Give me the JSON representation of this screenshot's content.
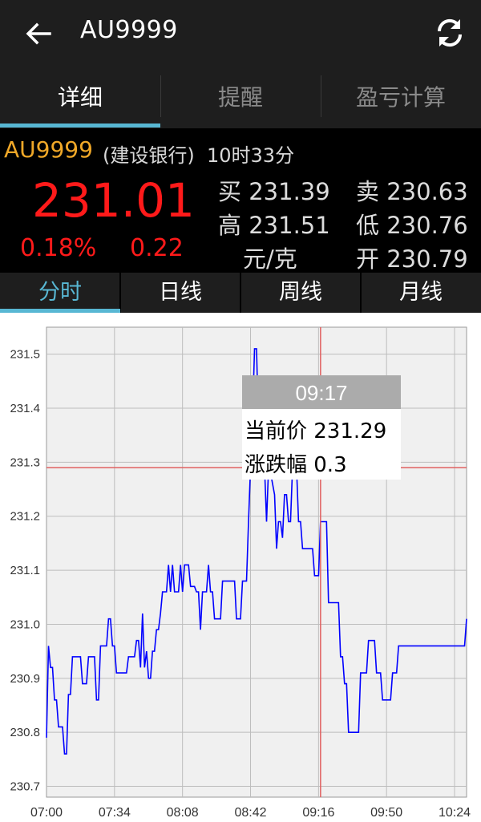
{
  "appbar": {
    "title": "AU9999",
    "back_icon": "arrow-left-icon",
    "refresh_icon": "refresh-icon"
  },
  "tabs": [
    {
      "label": "详细"
    },
    {
      "label": "提醒"
    },
    {
      "label": "盈亏计算"
    }
  ],
  "quote": {
    "symbol": "AU9999",
    "bank": "(建设银行)",
    "time": "10时33分",
    "price": "231.01",
    "change_pct": "0.18%",
    "change": "0.22",
    "buy_label": "买",
    "buy": "231.39",
    "sell_label": "卖",
    "sell": "230.63",
    "high_label": "高",
    "high": "231.51",
    "low_label": "低",
    "low": "230.76",
    "unit": "元/克",
    "open_label": "开",
    "open": "230.79"
  },
  "subtabs": [
    {
      "label": "分时"
    },
    {
      "label": "日线"
    },
    {
      "label": "周线"
    },
    {
      "label": "月线"
    }
  ],
  "colors": {
    "up": "#ff1a1a",
    "accent": "#58b7d3",
    "symbol": "#f0a828",
    "line": "#0000ff",
    "crosshair": "#e06060"
  },
  "tooltip": {
    "time": "09:17",
    "price_label": "当前价",
    "price": "231.29",
    "change_label": "涨跌幅",
    "change": "0.3"
  },
  "chart_data": {
    "type": "line",
    "xlabel": "",
    "ylabel": "",
    "x_ticks": [
      "07:00",
      "07:34",
      "08:08",
      "08:42",
      "09:16",
      "09:50",
      "10:24"
    ],
    "y_ticks": [
      "230.7",
      "230.8",
      "230.9",
      "231.0",
      "231.1",
      "231.2",
      "231.3",
      "231.4",
      "231.5"
    ],
    "x_range_minutes": [
      420,
      630
    ],
    "ylim": [
      230.68,
      231.55
    ],
    "crosshair": {
      "time": "09:17",
      "value": 231.29
    },
    "series": [
      {
        "x": [
          420,
          421,
          422,
          423,
          424,
          425,
          426,
          427,
          428,
          429,
          430,
          431,
          432,
          433,
          434,
          435,
          436,
          437,
          438,
          439,
          440,
          441,
          442,
          443,
          444,
          445,
          446,
          447,
          448,
          449,
          450,
          451,
          452,
          453,
          454,
          455,
          456,
          457,
          458,
          459,
          460,
          461,
          462,
          463,
          464,
          465,
          466,
          467,
          468,
          469,
          470,
          471,
          472,
          473,
          474,
          475,
          476,
          477,
          478,
          479,
          480,
          481,
          482,
          483,
          484,
          485,
          486,
          487,
          488,
          489,
          490,
          491,
          492,
          493,
          494,
          495,
          496,
          497,
          498,
          499,
          500,
          501,
          502,
          503,
          504,
          505,
          506,
          507,
          508,
          509,
          510,
          511,
          512,
          513,
          514,
          515,
          516,
          517,
          518,
          519,
          520,
          521,
          522,
          523,
          524,
          525,
          526,
          527,
          528,
          529,
          530,
          531,
          532,
          533,
          534,
          535,
          536,
          537,
          538,
          539,
          540,
          541,
          542,
          543,
          544,
          545,
          546,
          547,
          548,
          549,
          550,
          551,
          552,
          553,
          554,
          555,
          556,
          557,
          558,
          559,
          560,
          561,
          562,
          563,
          564,
          565,
          566,
          567,
          568,
          569,
          570,
          571,
          572,
          573,
          574,
          575,
          576,
          577,
          578,
          579,
          580,
          581,
          582,
          583,
          584,
          585,
          586,
          587,
          588,
          589,
          590,
          591,
          592,
          593,
          594,
          595,
          596,
          597,
          598,
          599,
          600,
          601,
          602,
          603,
          604,
          605,
          606,
          607,
          608,
          609,
          610,
          611,
          612,
          613,
          614,
          615,
          616,
          617,
          618,
          619,
          620,
          621,
          622,
          623,
          624,
          625,
          626,
          627,
          628,
          629,
          630
        ],
        "y": [
          230.79,
          230.96,
          230.92,
          230.92,
          230.86,
          230.86,
          230.81,
          230.81,
          230.81,
          230.76,
          230.76,
          230.87,
          230.87,
          230.94,
          230.94,
          230.94,
          230.94,
          230.94,
          230.89,
          230.89,
          230.89,
          230.94,
          230.94,
          230.94,
          230.94,
          230.86,
          230.86,
          230.96,
          230.96,
          230.96,
          230.96,
          231.01,
          231.01,
          230.96,
          230.96,
          230.91,
          230.91,
          230.91,
          230.91,
          230.91,
          230.91,
          230.94,
          230.94,
          230.94,
          230.94,
          230.97,
          230.97,
          230.92,
          231.02,
          230.92,
          230.95,
          230.9,
          230.9,
          230.95,
          230.95,
          230.99,
          230.99,
          231.02,
          231.06,
          231.06,
          231.06,
          231.11,
          231.06,
          231.11,
          231.06,
          231.06,
          231.06,
          231.11,
          231.06,
          231.11,
          231.11,
          231.11,
          231.07,
          231.07,
          231.07,
          231.06,
          231.06,
          230.99,
          231.06,
          231.06,
          231.06,
          231.11,
          231.06,
          231.06,
          231.01,
          231.01,
          231.01,
          231.01,
          231.08,
          231.08,
          231.08,
          231.08,
          231.08,
          231.08,
          231.08,
          231.01,
          231.01,
          231.01,
          231.08,
          231.08,
          231.08,
          231.19,
          231.29,
          231.38,
          231.51,
          231.51,
          231.36,
          231.36,
          231.29,
          231.29,
          231.19,
          231.29,
          231.28,
          231.26,
          231.24,
          231.14,
          231.19,
          231.19,
          231.16,
          231.24,
          231.24,
          231.19,
          231.19,
          231.29,
          231.29,
          231.29,
          231.19,
          231.19,
          231.14,
          231.14,
          231.14,
          231.14,
          231.14,
          231.14,
          231.09,
          231.09,
          231.09,
          231.19,
          231.19,
          231.19,
          231.19,
          231.04,
          231.04,
          231.04,
          231.04,
          231.04,
          231.04,
          230.94,
          230.94,
          230.89,
          230.89,
          230.8,
          230.8,
          230.8,
          230.8,
          230.8,
          230.8,
          230.91,
          230.91,
          230.91,
          230.91,
          230.97,
          230.97,
          230.97,
          230.97,
          230.91,
          230.91,
          230.91,
          230.86,
          230.86,
          230.86,
          230.86,
          230.86,
          230.91,
          230.91,
          230.91,
          230.96,
          230.96,
          230.96,
          230.96,
          230.96,
          230.96,
          230.96,
          230.96,
          230.96,
          230.96,
          230.96,
          230.96,
          230.96,
          230.96,
          230.96,
          230.96,
          230.96,
          230.96,
          230.96,
          230.96,
          230.96,
          230.96,
          230.96,
          230.96,
          230.96,
          230.96,
          230.96,
          230.96,
          230.96,
          230.96,
          230.96,
          230.96,
          230.96,
          230.96,
          231.01
        ]
      }
    ]
  }
}
